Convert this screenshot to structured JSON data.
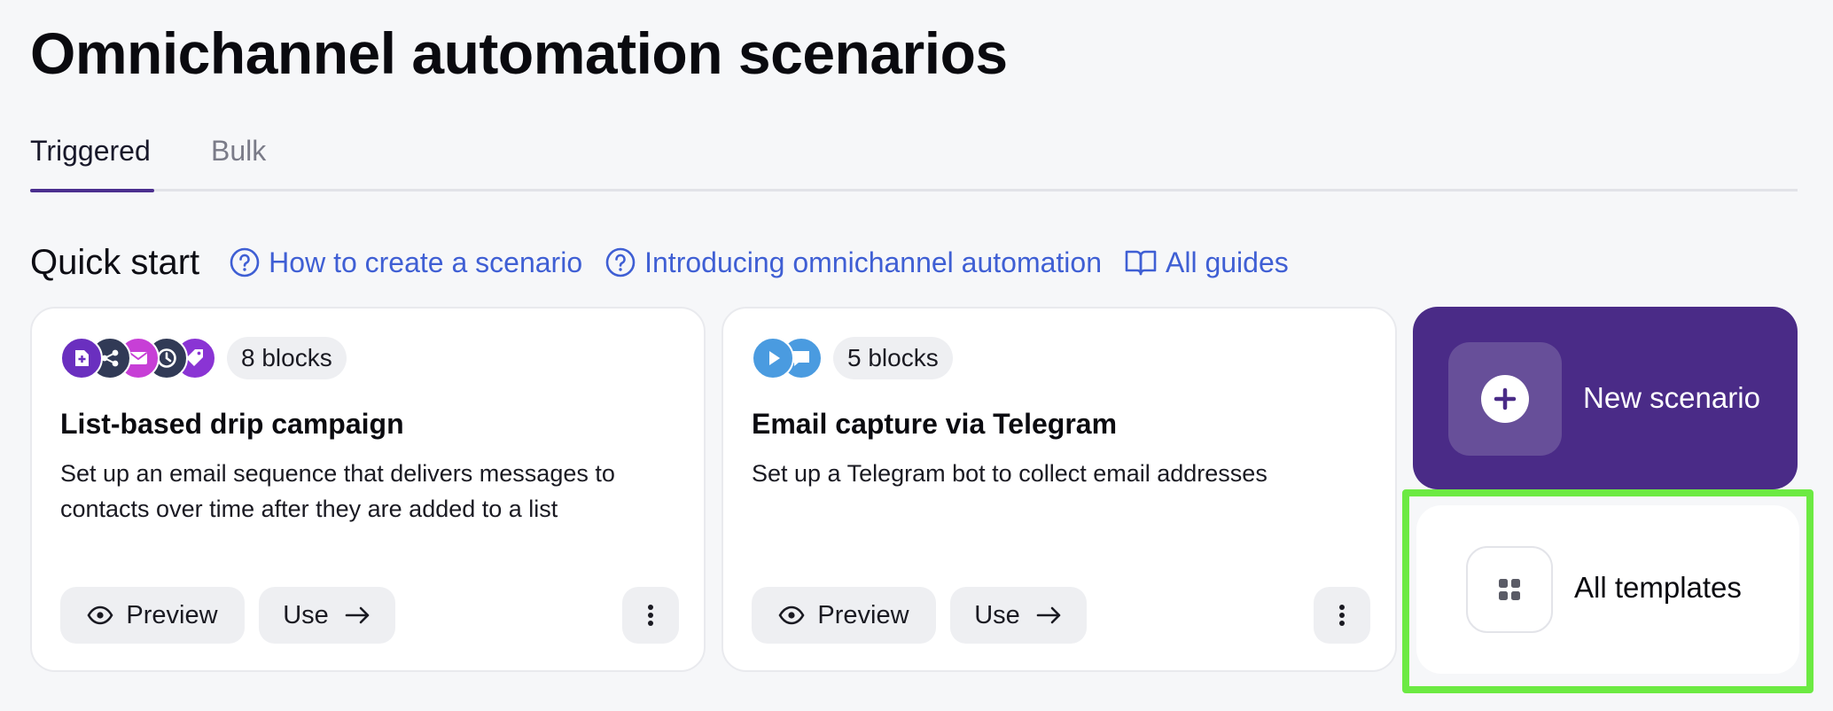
{
  "page": {
    "title": "Omnichannel automation scenarios"
  },
  "tabs": [
    {
      "label": "Triggered",
      "active": true
    },
    {
      "label": "Bulk",
      "active": false
    }
  ],
  "quick_start": {
    "title": "Quick start",
    "links": [
      {
        "label": "How to create a scenario",
        "icon": "help-circle-icon"
      },
      {
        "label": "Introducing omnichannel automation",
        "icon": "help-circle-icon"
      },
      {
        "label": "All guides",
        "icon": "open-book-icon"
      }
    ]
  },
  "cards": [
    {
      "blocks": "8 blocks",
      "title": "List-based drip campaign",
      "description": "Set up an email sequence that delivers messages to contacts over time after they are added to a list",
      "icons": [
        "add-contact-icon",
        "share-icon",
        "email-icon",
        "clock-icon",
        "tag-icon"
      ],
      "preview_label": "Preview",
      "use_label": "Use"
    },
    {
      "blocks": "5 blocks",
      "title": "Email capture via Telegram",
      "description": "Set up a Telegram bot to collect email addresses",
      "icons": [
        "play-icon",
        "chat-bubble-icon"
      ],
      "preview_label": "Preview",
      "use_label": "Use"
    }
  ],
  "new_scenario": {
    "label": "New scenario"
  },
  "all_templates": {
    "label": "All templates"
  },
  "colors": {
    "accent_purple": "#4a2b87",
    "link_blue": "#3f5fd4",
    "highlight_green": "#6cea42",
    "icon_purple": "#6a2fbf",
    "icon_navy": "#313a56",
    "icon_magenta": "#c73fd6",
    "icon_violet": "#8a34d4",
    "icon_sky": "#4a9be0"
  }
}
